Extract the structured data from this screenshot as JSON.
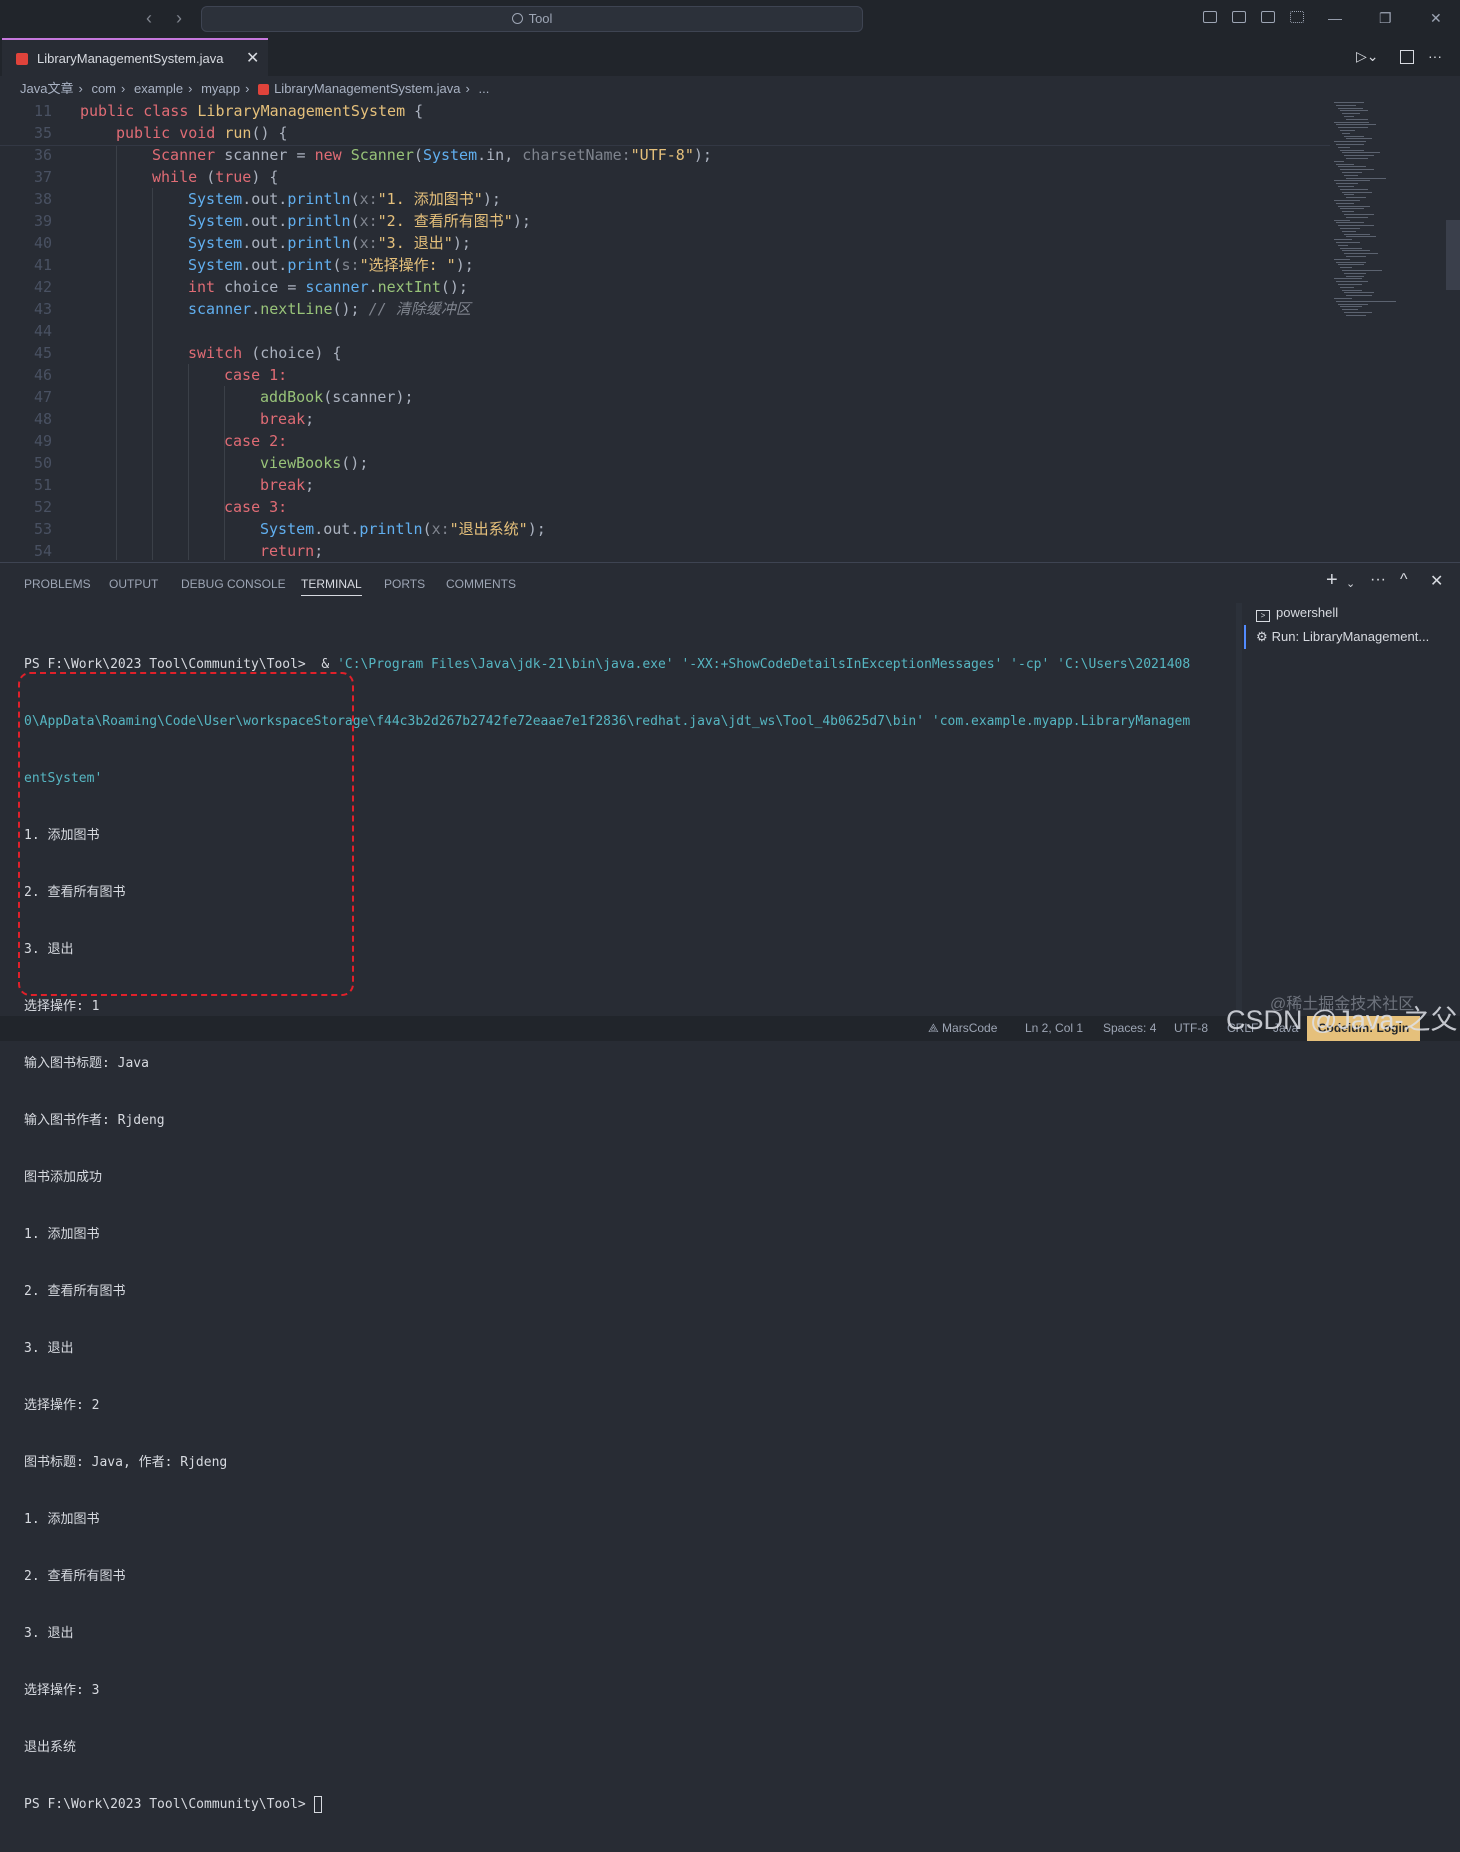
{
  "titlebar": {
    "search": "Tool",
    "back": "‹",
    "forward": "›",
    "minimize": "—",
    "restore": "❐",
    "close": "✕"
  },
  "tab": {
    "label": "LibraryManagementSystem.java",
    "close": "✕"
  },
  "breadcrumb": [
    "Java文章",
    "com",
    "example",
    "myapp",
    "LibraryManagementSystem.java",
    "..."
  ],
  "editor_lines": [
    {
      "n": "11"
    },
    {
      "n": "35"
    },
    {
      "n": "36"
    },
    {
      "n": "37"
    },
    {
      "n": "38"
    },
    {
      "n": "39"
    },
    {
      "n": "40"
    },
    {
      "n": "41"
    },
    {
      "n": "42"
    },
    {
      "n": "43"
    },
    {
      "n": "44"
    },
    {
      "n": "45"
    },
    {
      "n": "46"
    },
    {
      "n": "47"
    },
    {
      "n": "48"
    },
    {
      "n": "49"
    },
    {
      "n": "50"
    },
    {
      "n": "51"
    },
    {
      "n": "52"
    },
    {
      "n": "53"
    },
    {
      "n": "54"
    }
  ],
  "code": {
    "l11": [
      "public class ",
      "LibraryManagementSystem",
      " {"
    ],
    "l35": [
      "public void ",
      "run",
      "() {"
    ],
    "l36": [
      "Scanner",
      " scanner = ",
      "new ",
      "Scanner",
      "(",
      "System",
      ".",
      "in",
      ", ",
      "charsetName:",
      "\"UTF-8\"",
      ");"
    ],
    "l37": [
      "while ",
      "(",
      "true",
      ") {"
    ],
    "l38": [
      "System",
      ".out.",
      "println",
      "(",
      "x:",
      "\"1. 添加图书\"",
      ");"
    ],
    "l39": [
      "System",
      ".out.",
      "println",
      "(",
      "x:",
      "\"2. 查看所有图书\"",
      ");"
    ],
    "l40": [
      "System",
      ".out.",
      "println",
      "(",
      "x:",
      "\"3. 退出\"",
      ");"
    ],
    "l41": [
      "System",
      ".out.",
      "print",
      "(",
      "s:",
      "\"选择操作: \"",
      ");"
    ],
    "l42": [
      "int ",
      "choice = ",
      "scanner",
      ".",
      "nextInt",
      "();"
    ],
    "l43": [
      "scanner",
      ".",
      "nextLine",
      "(); ",
      "// 清除缓冲区"
    ],
    "l45": [
      "switch ",
      "(choice) {"
    ],
    "l46": [
      "case ",
      "1:"
    ],
    "l47": [
      "addBook",
      "(scanner);"
    ],
    "l48": [
      "break",
      ";"
    ],
    "l49": [
      "case ",
      "2:"
    ],
    "l50": [
      "viewBooks",
      "();"
    ],
    "l51": [
      "break",
      ";"
    ],
    "l52": [
      "case ",
      "3:"
    ],
    "l53": [
      "System",
      ".out.",
      "println",
      "(",
      "x:",
      "\"退出系统\"",
      ");"
    ],
    "l54": [
      "return",
      ";"
    ]
  },
  "panel": {
    "tabs": [
      "PROBLEMS",
      "OUTPUT",
      "DEBUG CONSOLE",
      "TERMINAL",
      "PORTS",
      "COMMENTS"
    ],
    "active_tab": "TERMINAL",
    "actions": {
      "add": "+",
      "more": "···",
      "maximize": "^",
      "close": "✕"
    },
    "terminals": [
      "powershell",
      "Run: LibraryManagement..."
    ]
  },
  "terminal": {
    "prompt1": "PS F:\\Work\\2023 Tool\\Community\\Tool>  & ",
    "cmd1": "'C:\\Program Files\\Java\\jdk-21\\bin\\java.exe' '-XX:+ShowCodeDetailsInExceptionMessages' '-cp' 'C:\\Users\\2021408",
    "cmd2": "0\\AppData\\Roaming\\Code\\User\\workspaceStorage\\f44c3b2d267b2742fe72eaae7e1f2836\\redhat.java\\jdt_ws\\Tool_4b0625d7\\bin' 'com.example.myapp.LibraryManagem",
    "cmd3": "entSystem'",
    "output": [
      "1. 添加图书",
      "2. 查看所有图书",
      "3. 退出",
      "选择操作: 1",
      "输入图书标题: Java",
      "输入图书作者: Rjdeng",
      "图书添加成功",
      "1. 添加图书",
      "2. 查看所有图书",
      "3. 退出",
      "选择操作: 2",
      "图书标题: Java, 作者: Rjdeng",
      "1. 添加图书",
      "2. 查看所有图书",
      "3. 退出",
      "选择操作: 3",
      "退出系统"
    ],
    "prompt_end": "PS F:\\Work\\2023 Tool\\Community\\Tool> "
  },
  "statusbar": {
    "marscode": "MarsCode",
    "position": "Ln 2, Col 1",
    "spaces": "Spaces: 4",
    "encoding": "UTF-8",
    "eol": "CRLF",
    "language": "Java",
    "codeium": "Codeium: Login"
  },
  "watermark": {
    "main": "CSDN @Java-之父",
    "sub": "@稀土掘金技术社区"
  }
}
